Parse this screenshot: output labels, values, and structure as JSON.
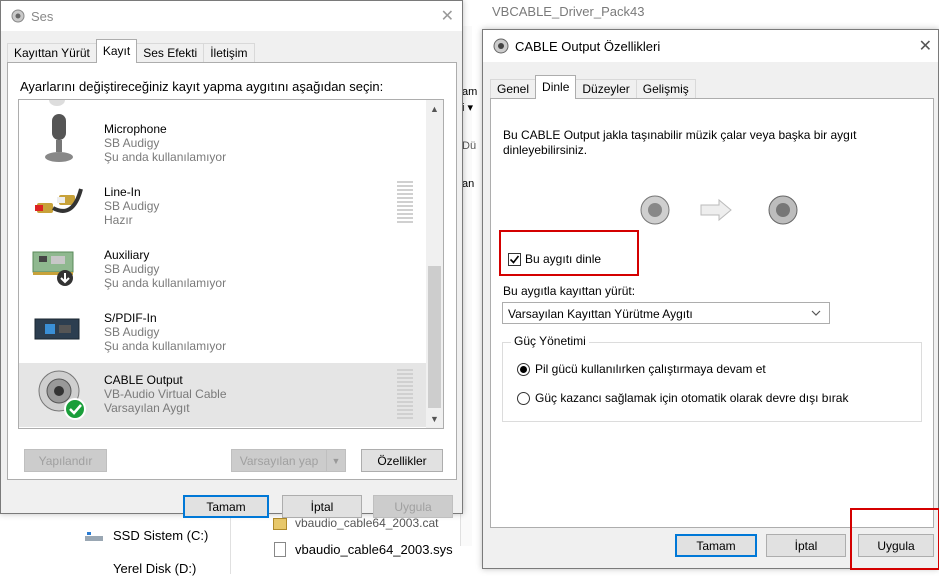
{
  "background": {
    "window_title": "VBCABLE_Driver_Pack43",
    "files": [
      {
        "name": "vbaudio_cable64_2003.cat"
      },
      {
        "name": "vbaudio_cable64_2003.sys"
      }
    ],
    "drives": [
      {
        "name": "SSD Sistem (C:)"
      },
      {
        "name": "Yerel Disk (D:)"
      }
    ],
    "side_fragments": [
      "am",
      "i ▾",
      "Dü",
      "an"
    ]
  },
  "sound_dialog": {
    "title": "Ses",
    "close_glyph": "✕",
    "tabs": [
      "Kayıttan Yürüt",
      "Kayıt",
      "Ses Efekti",
      "İletişim"
    ],
    "active_tab": "Kayıt",
    "instruction": "Ayarlarını değiştireceğiniz kayıt yapma aygıtını aşağıdan seçin:",
    "devices": [
      {
        "name": "Microphone",
        "device": "SB Audigy",
        "status": "Şu anda kullanılamıyor",
        "icon": "microphone-icon",
        "selected": false
      },
      {
        "name": "Line-In",
        "device": "SB Audigy",
        "status": "Hazır",
        "icon": "line-in-cable-icon",
        "selected": false
      },
      {
        "name": "Auxiliary",
        "device": "SB Audigy",
        "status": "Şu anda kullanılamıyor",
        "icon": "sound-card-icon",
        "selected": false
      },
      {
        "name": "S/PDIF-In",
        "device": "SB Audigy",
        "status": "Şu anda kullanılamıyor",
        "icon": "spdif-box-icon",
        "selected": false
      },
      {
        "name": "CABLE Output",
        "device": "VB-Audio Virtual Cable",
        "status": "Varsayılan Aygıt",
        "icon": "virtual-cable-icon",
        "selected": true
      }
    ],
    "buttons": {
      "configure": "Yapılandır",
      "set_default": "Varsayılan yap",
      "properties": "Özellikler",
      "ok": "Tamam",
      "cancel": "İptal",
      "apply": "Uygula"
    }
  },
  "props_dialog": {
    "title": "CABLE Output Özellikleri",
    "close_glyph": "✕",
    "tabs": [
      "Genel",
      "Dinle",
      "Düzeyler",
      "Gelişmiş"
    ],
    "active_tab": "Dinle",
    "description": "Bu CABLE Output jakla taşınabilir müzik çalar veya başka bir aygıt dinleyebilirsiniz.",
    "listen_checkbox_label": "Bu aygıtı dinle",
    "listen_checked": true,
    "playback_label": "Bu aygıtla kayıttan yürüt:",
    "playback_value": "Varsayılan Kayıttan Yürütme Aygıtı",
    "power_group_label": "Güç Yönetimi",
    "power_options": [
      {
        "label": "Pil gücü kullanılırken çalıştırmaya devam et",
        "selected": true
      },
      {
        "label": "Güç kazancı sağlamak için otomatik olarak devre dışı bırak",
        "selected": false
      }
    ],
    "buttons": {
      "ok": "Tamam",
      "cancel": "İptal",
      "apply": "Uygula"
    }
  },
  "colors": {
    "highlight_red": "#d40000",
    "accent_blue": "#0078d7",
    "selected_row": "#e5e5e5",
    "status_green": "#1a9e3a"
  }
}
